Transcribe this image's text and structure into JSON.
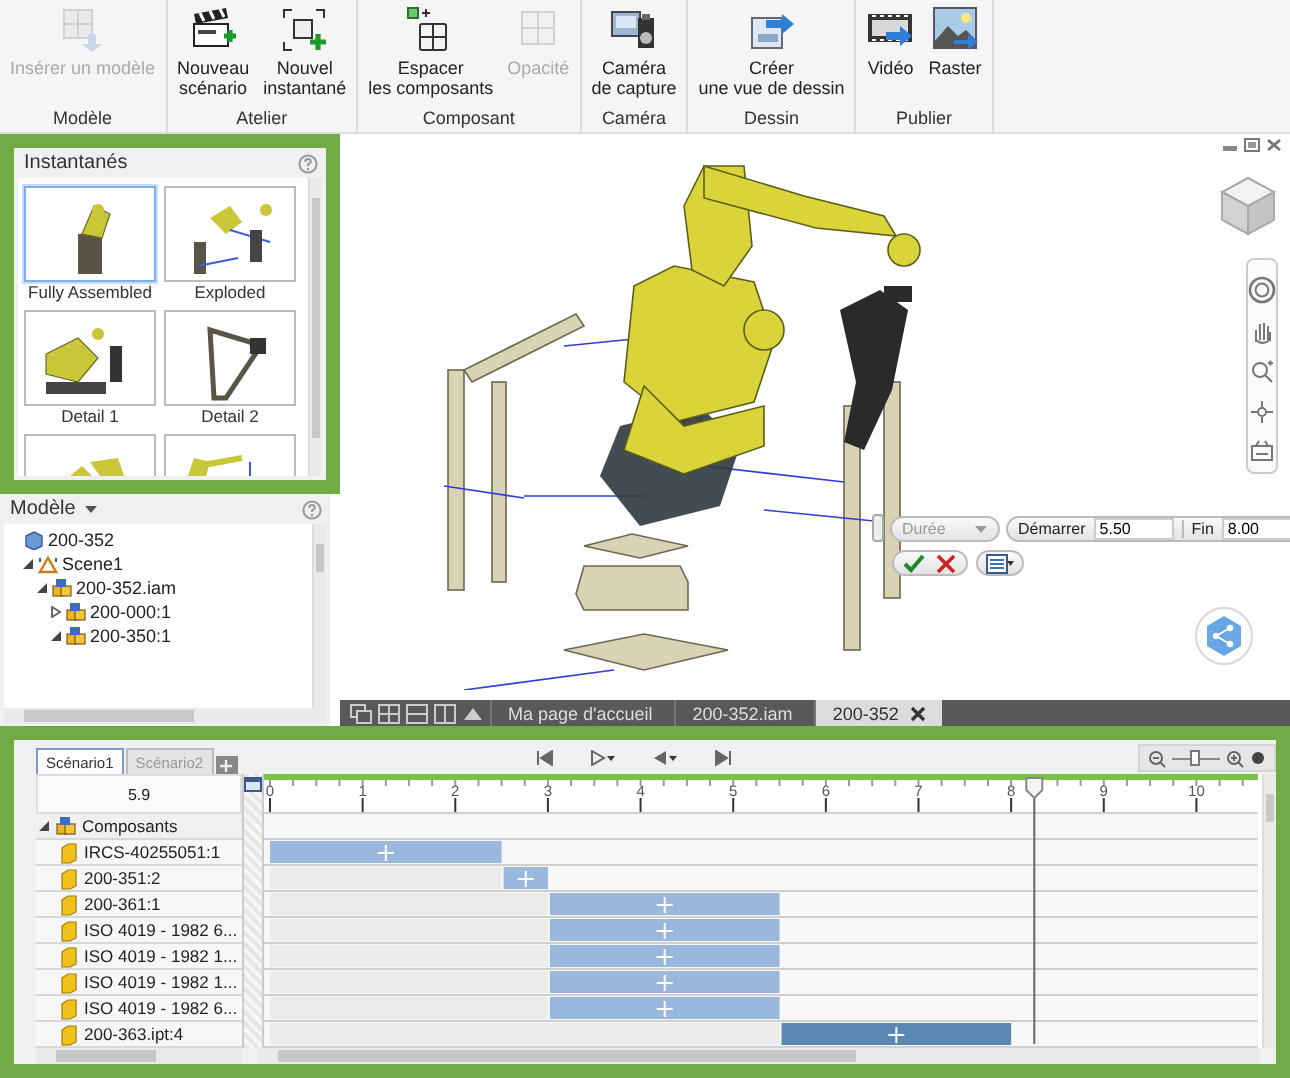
{
  "ribbon": {
    "groups": [
      {
        "label": "Modèle",
        "buttons": [
          {
            "kind": "insert-model",
            "lines": [
              "Insérer un modèle"
            ],
            "disabled": true
          }
        ]
      },
      {
        "label": "Atelier",
        "buttons": [
          {
            "kind": "new-storyboard",
            "lines": [
              "Nouveau",
              "scénario"
            ],
            "disabled": false
          },
          {
            "kind": "new-snapshot",
            "lines": [
              "Nouvel",
              "instantané"
            ],
            "disabled": false
          }
        ]
      },
      {
        "label": "Composant",
        "buttons": [
          {
            "kind": "tweak",
            "lines": [
              "Espacer",
              "les composants"
            ],
            "disabled": false
          },
          {
            "kind": "opacity",
            "lines": [
              "Opacité"
            ],
            "disabled": true
          }
        ]
      },
      {
        "label": "Caméra",
        "buttons": [
          {
            "kind": "camera",
            "lines": [
              "Caméra",
              "de capture"
            ],
            "disabled": false
          }
        ]
      },
      {
        "label": "Dessin",
        "buttons": [
          {
            "kind": "drawing-view",
            "lines": [
              "Créer",
              "une vue de dessin"
            ],
            "disabled": false
          }
        ]
      },
      {
        "label": "Publier",
        "buttons": [
          {
            "kind": "video",
            "lines": [
              "Vidéo"
            ],
            "disabled": false
          },
          {
            "kind": "raster",
            "lines": [
              "Raster"
            ],
            "disabled": false
          }
        ]
      }
    ]
  },
  "snapshots": {
    "title": "Instantanés",
    "items": [
      {
        "label": "Fully Assembled",
        "selected": true
      },
      {
        "label": "Exploded",
        "selected": false
      },
      {
        "label": "Detail 1",
        "selected": false
      },
      {
        "label": "Detail 2",
        "selected": false
      },
      {
        "selected": false
      },
      {
        "selected": false
      }
    ]
  },
  "model": {
    "title": "Modèle",
    "tree": [
      {
        "label": "200-352",
        "kind": "root",
        "children": [
          {
            "label": "Scene1",
            "kind": "scene",
            "expanded": true,
            "children": [
              {
                "label": "200-352.iam",
                "kind": "assembly",
                "expanded": true,
                "children": [
                  {
                    "label": "200-000:1",
                    "kind": "assembly",
                    "expanded": false
                  },
                  {
                    "label": "200-350:1",
                    "kind": "assembly",
                    "expanded": true
                  }
                ]
              }
            ]
          }
        ]
      }
    ]
  },
  "animation_panel": {
    "duration": {
      "value": "Durée",
      "disabled": true
    },
    "start": {
      "label": "Démarrer",
      "value": "5.50"
    },
    "end": {
      "label": "Fin",
      "value": "8.00"
    }
  },
  "doc_tabs": [
    {
      "label": "Ma page d'accueil",
      "selected": false
    },
    {
      "label": "200-352.iam",
      "selected": false
    },
    {
      "label": "200-352",
      "selected": true,
      "closable": true
    }
  ],
  "timeline": {
    "tabs": [
      {
        "label": "Scénario1",
        "selected": true
      },
      {
        "label": "Scénario2",
        "selected": false
      }
    ],
    "current_time": "5.9",
    "zoom": {
      "level": 0.5
    },
    "group": {
      "label": "Composants",
      "expanded": true
    },
    "chart_data": {
      "type": "bar",
      "orientation": "horizontal",
      "stacked": true,
      "categories": [
        "IRCS-40255051:1",
        "200-351:2",
        "200-361:1",
        "ISO 4019 - 1982 6...",
        "ISO 4019 - 1982 1...",
        "ISO 4019 - 1982 1...",
        "ISO 4019 - 1982 6...",
        "200-363.ipt:4"
      ],
      "series": [
        {
          "color": "#ebebeb",
          "values": [
            0,
            2.5,
            3,
            3,
            3,
            3,
            3,
            5.5
          ]
        },
        {
          "color": "#9ab7de",
          "values": [
            2.5,
            0.5,
            2.5,
            2.5,
            2.5,
            2.5,
            2.5,
            null
          ]
        },
        {
          "color": "#5b87b5",
          "values": [
            null,
            null,
            null,
            null,
            null,
            null,
            null,
            2.5
          ]
        }
      ],
      "xlim": [
        0,
        10.6
      ],
      "xticks": [
        0,
        1,
        2,
        3,
        4,
        5,
        6,
        7,
        8,
        9,
        10
      ],
      "ref_lines": [
        {
          "axis": "x",
          "value": 8.25
        }
      ]
    }
  }
}
